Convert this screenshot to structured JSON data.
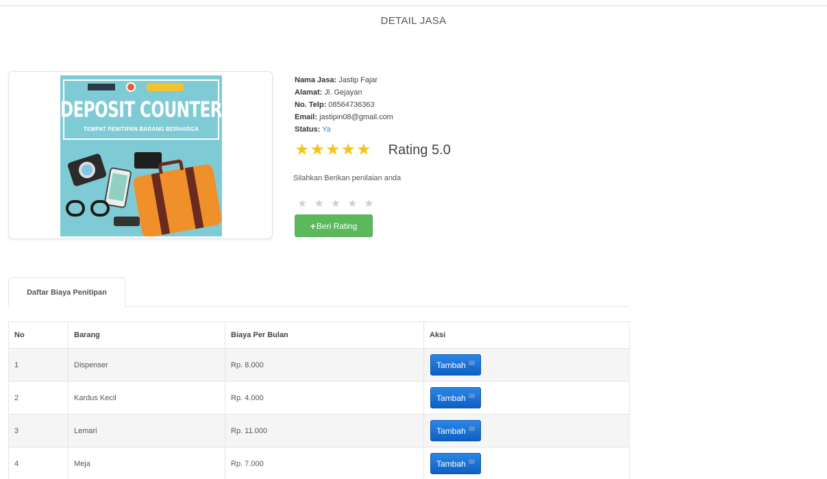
{
  "page": {
    "title": "DETAIL JASA"
  },
  "service": {
    "name_label": "Nama Jasa:",
    "name_value": "Jastip Fajar",
    "address_label": "Alamat:",
    "address_value": "Jl. Gejayan",
    "phone_label": "No. Telp:",
    "phone_value": "08564736363",
    "email_label": "Email:",
    "email_value": "jastipin08@gmail.com",
    "status_label": "Status:",
    "status_value": "Ya",
    "rating_stars": 5,
    "rating_text": "Rating 5.0"
  },
  "poster": {
    "title": "DEPOSIT COUNTER",
    "subtitle": "TEMPAT PENITIPAN BARANG BERHARGA"
  },
  "rate": {
    "prompt": "Silahkan Berikan penilaian anda",
    "button_label": "Beri Rating"
  },
  "tabs": [
    {
      "label": "Daftar Biaya Penitipan",
      "active": true
    }
  ],
  "table": {
    "headers": [
      "No",
      "Barang",
      "Biaya Per Bulan",
      "Aksi"
    ],
    "rows": [
      {
        "no": "1",
        "barang": "Dispenser",
        "biaya": "Rp. 8.000",
        "action": "Tambah"
      },
      {
        "no": "2",
        "barang": "Kardus Kecil",
        "biaya": "Rp. 4.000",
        "action": "Tambah"
      },
      {
        "no": "3",
        "barang": "Lemari",
        "biaya": "Rp. 11.000",
        "action": "Tambah"
      },
      {
        "no": "4",
        "barang": "Meja",
        "biaya": "Rp. 7.000",
        "action": "Tambah"
      }
    ]
  },
  "colors": {
    "star": "#f5c518",
    "rate_button": "#5cb85c",
    "add_button": "#1a73d9",
    "status": "#3a87c8"
  }
}
